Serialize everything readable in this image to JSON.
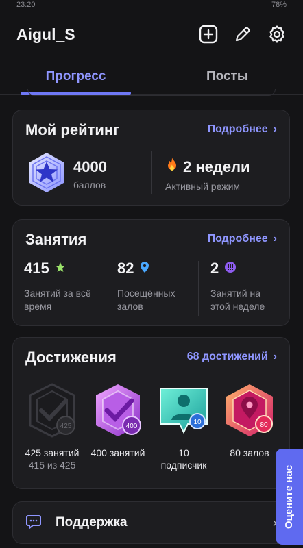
{
  "status": {
    "time": "23:20",
    "battery": "78%"
  },
  "header": {
    "username": "Aigul_S"
  },
  "tabs": [
    {
      "label": "Прогресс"
    },
    {
      "label": "Посты"
    }
  ],
  "rating": {
    "title": "Мой рейтинг",
    "more": "Подробнее",
    "points_value": "4000",
    "points_label": "баллов",
    "streak_value": "2 недели",
    "streak_label": "Активный режим"
  },
  "sessions": {
    "title": "Занятия",
    "more": "Подробнее",
    "stats": [
      {
        "value": "415",
        "label": "Занятий за всё время"
      },
      {
        "value": "82",
        "label": "Посещённых залов"
      },
      {
        "value": "2",
        "label": "Занятий на этой неделе"
      }
    ]
  },
  "achievements": {
    "title": "Достижения",
    "more": "68 достижений",
    "items": [
      {
        "badge": "425",
        "label": "425 занятий",
        "progress": "415 из 425"
      },
      {
        "badge": "400",
        "label": "400 занятий",
        "progress": ""
      },
      {
        "badge": "10",
        "label": "10 подписчик",
        "progress": ""
      },
      {
        "badge": "80",
        "label": "80 залов",
        "progress": ""
      }
    ]
  },
  "support": {
    "label": "Поддержка"
  },
  "rate_us": {
    "label": "Оцените нас"
  },
  "colors": {
    "accent": "#8f96ff",
    "background": "#141416",
    "card": "#1d1d20"
  }
}
